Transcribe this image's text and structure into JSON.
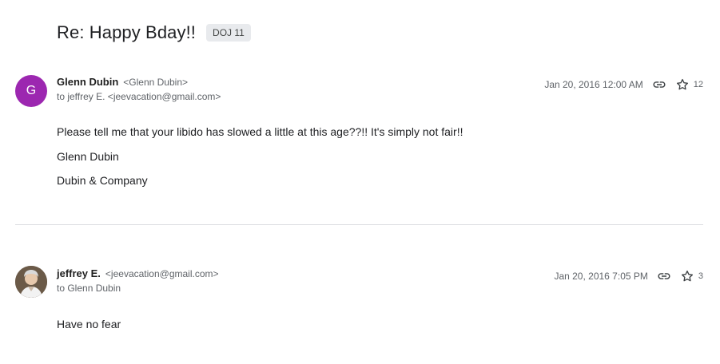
{
  "thread": {
    "subject": "Re: Happy Bday!!",
    "label": "DOJ 11"
  },
  "messages": [
    {
      "avatar_letter": "G",
      "avatar_color": "#9c27b0",
      "sender_name": "Glenn Dubin",
      "sender_email": "<Glenn Dubin>",
      "to_line": "to jeffrey E. <jeevacation@gmail.com>",
      "date": "Jan 20, 2016 12:00 AM",
      "star_count": "12",
      "body": [
        "Please tell me that your libido has slowed a little at this age??!! It's simply not fair!!",
        "Glenn Dubin",
        "Dubin & Company"
      ]
    },
    {
      "avatar_letter": "",
      "sender_name": "jeffrey E.",
      "sender_email": "<jeevacation@gmail.com>",
      "to_line": "to Glenn Dubin",
      "date": "Jan 20, 2016 7:05 PM",
      "star_count": "3",
      "body": [
        "Have no fear"
      ]
    }
  ],
  "icons": {
    "link": "link-icon",
    "star": "star-icon"
  }
}
